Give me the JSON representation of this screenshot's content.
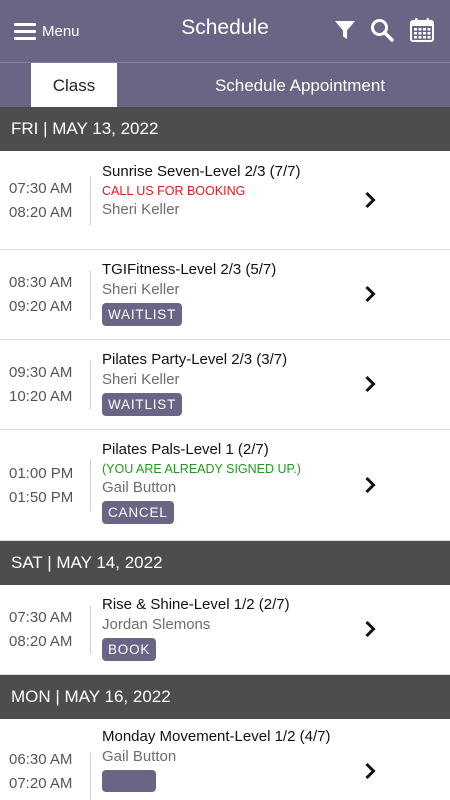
{
  "header": {
    "menu_label": "Menu",
    "title": "Schedule",
    "accent": "#6b6585"
  },
  "tabs": [
    {
      "label": "Class",
      "active": true
    },
    {
      "label": "Schedule Appointment",
      "active": false
    }
  ],
  "days": [
    {
      "date": "FRI | MAY 13, 2022",
      "classes": [
        {
          "start": "07:30 AM",
          "end": "08:20 AM",
          "name": "Sunrise Seven-Level 2/3 (7/7)",
          "note": "CALL US FOR BOOKING",
          "note_color": "#e01a1a",
          "instructor": "Sheri Keller",
          "button": ""
        },
        {
          "start": "08:30 AM",
          "end": "09:20 AM",
          "name": "TGIFitness-Level 2/3 (5/7)",
          "note": "",
          "instructor": "Sheri Keller",
          "button": "WAITLIST"
        },
        {
          "start": "09:30 AM",
          "end": "10:20 AM",
          "name": "Pilates Party-Level 2/3 (3/7)",
          "note": "",
          "instructor": "Sheri Keller",
          "button": "WAITLIST"
        },
        {
          "start": "01:00 PM",
          "end": "01:50 PM",
          "name": "Pilates Pals-Level 1 (2/7)",
          "note": "(YOU ARE ALREADY SIGNED UP.)",
          "note_color": "#1f9a1f",
          "instructor": "Gail Button",
          "button": "CANCEL"
        }
      ]
    },
    {
      "date": "SAT | MAY 14, 2022",
      "classes": [
        {
          "start": "07:30 AM",
          "end": "08:20 AM",
          "name": "Rise & Shine-Level 1/2 (2/7)",
          "note": "",
          "instructor": "Jordan Slemons",
          "button": "BOOK"
        }
      ]
    },
    {
      "date": "MON | MAY 16, 2022",
      "classes": [
        {
          "start": "06:30 AM",
          "end": "07:20 AM",
          "name": "Monday Movement-Level 1/2 (4/7)",
          "note": "",
          "instructor": "Gail Button",
          "button": ""
        }
      ]
    }
  ]
}
